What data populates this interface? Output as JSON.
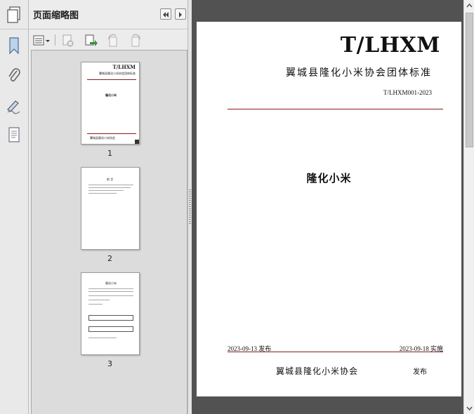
{
  "panel": {
    "title": "页面缩略图",
    "thumbnails": [
      {
        "page": "1",
        "selected": true
      },
      {
        "page": "2",
        "selected": false
      },
      {
        "page": "3",
        "selected": false
      }
    ],
    "thumb1": {
      "code": "T/LHXM",
      "std": "翼城县隆化小米协会团体标准",
      "title": "隆化小米",
      "org": "翼城县隆化小米协会"
    },
    "thumb2": {
      "heading": "前 言"
    },
    "thumb3": {
      "heading": "隆化小米"
    }
  },
  "rail_icons": [
    "pages-panel-icon",
    "bookmark-icon",
    "attachment-icon",
    "signature-icon",
    "layers-icon"
  ],
  "toolbar_icons": [
    "options-icon",
    "delete-page-icon",
    "insert-page-icon",
    "rotate-ccw-icon",
    "rotate-cw-icon"
  ],
  "document": {
    "code": "T/LHXM",
    "standard_type": "翼城县隆化小米协会团体标准",
    "number": "T/LHXM001-2023",
    "title": "隆化小米",
    "publish_date": "2023-09-13",
    "publish_label": "发布",
    "implement_date": "2023-09-18",
    "implement_label": "实施",
    "organization": "翼城县隆化小米协会",
    "publish_word": "发布"
  },
  "colors": {
    "rule": "#8a1a1a",
    "doc_background": "#525252",
    "selection": "#333333"
  }
}
